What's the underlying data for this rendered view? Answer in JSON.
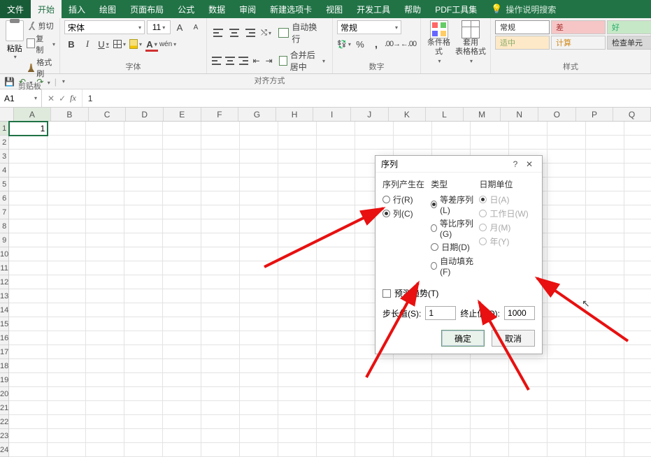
{
  "tabs": {
    "file": "文件",
    "home": "开始",
    "insert": "插入",
    "draw": "绘图",
    "layout": "页面布局",
    "formulas": "公式",
    "data": "数据",
    "review": "审阅",
    "newtab": "新建选项卡",
    "view": "视图",
    "dev": "开发工具",
    "help": "帮助",
    "pdf": "PDF工具集",
    "search": "操作说明搜索"
  },
  "groups": {
    "clipboard": "剪贴板",
    "font": "字体",
    "alignment": "对齐方式",
    "number": "数字",
    "styles": "样式"
  },
  "clipboard": {
    "paste": "粘贴",
    "cut": "剪切",
    "copy": "复制",
    "painter": "格式刷"
  },
  "font": {
    "name": "宋体",
    "size": "11"
  },
  "alignment": {
    "wrap": "自动换行",
    "merge": "合并后居中"
  },
  "number": {
    "format": "常规"
  },
  "cond": {
    "cf": "条件格式",
    "tf": "套用\n表格格式"
  },
  "style_cells": {
    "normal": "常规",
    "bad": "差",
    "good": "好",
    "neutral": "适中",
    "calc": "计算",
    "check": "检查单元"
  },
  "namebox": "A1",
  "formula": "1",
  "cell_value": "1",
  "columns": [
    "A",
    "B",
    "C",
    "D",
    "E",
    "F",
    "G",
    "H",
    "I",
    "J",
    "K",
    "L",
    "M",
    "N",
    "O",
    "P",
    "Q"
  ],
  "dialog": {
    "title": "序列",
    "help": "?",
    "section_in": "序列产生在",
    "in_row": "行(R)",
    "in_col": "列(C)",
    "section_type": "类型",
    "type_arith": "等差序列(L)",
    "type_geo": "等比序列(G)",
    "type_date": "日期(D)",
    "type_auto": "自动填充(F)",
    "section_unit": "日期单位",
    "unit_day": "日(A)",
    "unit_work": "工作日(W)",
    "unit_month": "月(M)",
    "unit_year": "年(Y)",
    "predict": "预测趋势(T)",
    "step_label": "步长值(S):",
    "step_value": "1",
    "stop_label": "终止值(O):",
    "stop_value": "1000",
    "ok": "确定",
    "cancel": "取消"
  },
  "chart_data": null
}
